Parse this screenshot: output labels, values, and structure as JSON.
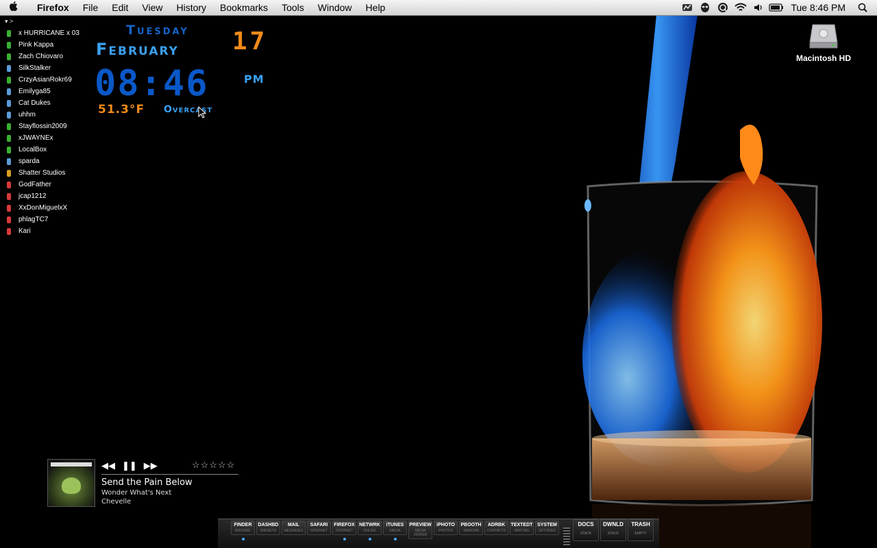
{
  "menubar": {
    "app_name": "Firefox",
    "menus": [
      "File",
      "Edit",
      "View",
      "History",
      "Bookmarks",
      "Tools",
      "Window",
      "Help"
    ],
    "status_icons": [
      "stats-icon",
      "alien-icon",
      "quicksilver-icon",
      "wifi-icon",
      "volume-icon",
      "battery-icon"
    ],
    "clock": "Tue 8:46 PM"
  },
  "buddy_list": {
    "toggle": "▾ >",
    "buddies": [
      {
        "name": "x HURRICANE x 03",
        "color": "#3ab030"
      },
      {
        "name": "Pink Kappa",
        "color": "#3ab030"
      },
      {
        "name": "Zach Chiovaro",
        "color": "#3ab030"
      },
      {
        "name": "SilkStalker",
        "color": "#5a9bd8"
      },
      {
        "name": "CrzyAsianRokr69",
        "color": "#3ab030"
      },
      {
        "name": "Emilyga85",
        "color": "#5a9bd8"
      },
      {
        "name": "Cat Dukes",
        "color": "#5a9bd8"
      },
      {
        "name": "uhhm",
        "color": "#5a9bd8"
      },
      {
        "name": "Stayflossin2009",
        "color": "#3ab030"
      },
      {
        "name": "xJWAYNEx",
        "color": "#3ab030"
      },
      {
        "name": "LocalBox",
        "color": "#3ab030"
      },
      {
        "name": "sparda",
        "color": "#5a9bd8"
      },
      {
        "name": "Shatter Studios",
        "color": "#d8a020"
      },
      {
        "name": "GodFather",
        "color": "#d83a3a"
      },
      {
        "name": "jcap1212",
        "color": "#d83a3a"
      },
      {
        "name": "XxDonMiguelxX",
        "color": "#d83a3a"
      },
      {
        "name": "phlagTC7",
        "color": "#d83a3a"
      },
      {
        "name": "Kari",
        "color": "#d83a3a"
      }
    ]
  },
  "clock_widget": {
    "day": "Tuesday",
    "month": "February",
    "date": "17",
    "time": "08:46",
    "ampm": "PM",
    "temperature": "51.3°F",
    "condition": "Overcast"
  },
  "desktop_icons": [
    {
      "label": "Macintosh HD",
      "icon": "hard-drive-icon"
    }
  ],
  "player": {
    "track": "Send the Pain Below",
    "album": "Wonder What's Next",
    "artist": "Chevelle",
    "rating": "☆☆☆☆☆",
    "prev_label": "◀◀",
    "pause_label": "❚❚",
    "next_label": "▶▶"
  },
  "dock": {
    "items": [
      {
        "label": "FINDER",
        "sub": "BROWSE",
        "running": true
      },
      {
        "label": "DASHBD",
        "sub": "WIDGETS",
        "running": false
      },
      {
        "label": "MAIL",
        "sub": "MESSAGES",
        "running": false
      },
      {
        "label": "SAFARI",
        "sub": "INTERNET",
        "running": false
      },
      {
        "label": "FIREFOX",
        "sub": "INTERNET",
        "running": true
      },
      {
        "label": "NETWRK",
        "sub": "ONLINE",
        "running": true
      },
      {
        "label": "iTUNES",
        "sub": "MEDIA",
        "running": true
      },
      {
        "label": "PREVIEW",
        "sub": "MEDIA VIEWER",
        "running": false
      },
      {
        "label": "iPHOTO",
        "sub": "PHOTOS",
        "running": false
      },
      {
        "label": "PBOOTH",
        "sub": "WEBCAM",
        "running": false
      },
      {
        "label": "ADRBK",
        "sub": "CONTACTS",
        "running": false
      },
      {
        "label": "TEXTEDT",
        "sub": "WRITING",
        "running": false
      },
      {
        "label": "SYSTEM",
        "sub": "SETTINGS",
        "running": false
      }
    ],
    "stacks": [
      {
        "label": "DOCS",
        "sub": "STACK"
      },
      {
        "label": "DWNLD",
        "sub": "STACK"
      },
      {
        "label": "TRASH",
        "sub": "EMPTY"
      }
    ]
  },
  "colors": {
    "accent_blue": "#1464c8",
    "accent_orange": "#f28a1a"
  }
}
